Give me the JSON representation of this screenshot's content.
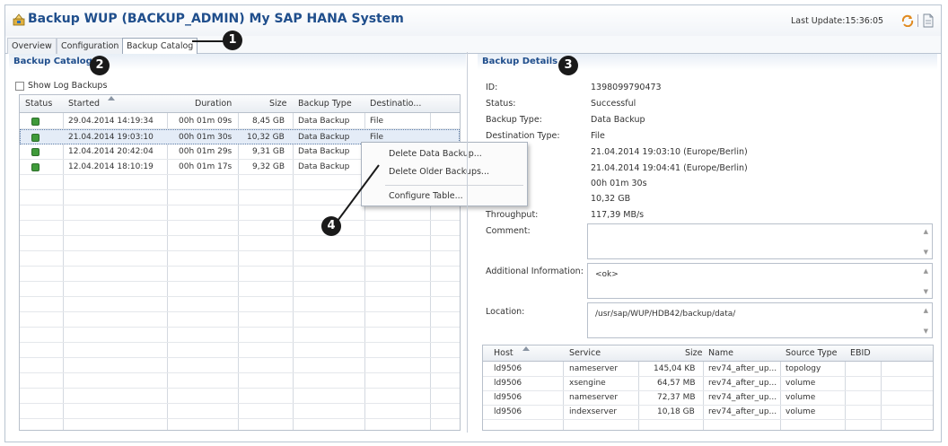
{
  "window": {
    "title": "Backup WUP (BACKUP_ADMIN) My SAP HANA System",
    "last_update": "Last Update:15:36:05"
  },
  "tabs": [
    {
      "label": "Overview"
    },
    {
      "label": "Configuration"
    },
    {
      "label": "Backup Catalog"
    }
  ],
  "callouts": [
    "1",
    "2",
    "3",
    "4"
  ],
  "catalog": {
    "header": "Backup Catalog",
    "show_log_label": "Show Log Backups",
    "columns": [
      "Status",
      "Started",
      "Duration",
      "Size",
      "Backup Type",
      "Destinatio..."
    ],
    "rows": [
      {
        "started": "29.04.2014 14:19:34",
        "duration": "00h 01m 09s",
        "size": "8,45 GB",
        "type": "Data Backup",
        "dest": "File"
      },
      {
        "started": "21.04.2014 19:03:10",
        "duration": "00h 01m 30s",
        "size": "10,32 GB",
        "type": "Data Backup",
        "dest": "File"
      },
      {
        "started": "12.04.2014 20:42:04",
        "duration": "00h 01m 29s",
        "size": "9,31 GB",
        "type": "Data Backup",
        "dest": ""
      },
      {
        "started": "12.04.2014 18:10:19",
        "duration": "00h 01m 17s",
        "size": "9,32 GB",
        "type": "Data Backup",
        "dest": ""
      }
    ],
    "status_color": "#3f9a3a"
  },
  "context_menu": {
    "items": [
      "Delete Data Backup...",
      "Delete Older Backups...",
      "Configure Table..."
    ]
  },
  "details": {
    "header": "Backup Details",
    "id_label": "ID:",
    "id_value": "1398099790473",
    "status_label": "Status:",
    "status_value": "Successful",
    "type_label": "Backup Type:",
    "type_value": "Data Backup",
    "dest_label": "Destination Type:",
    "dest_value": "File",
    "started_value": "21.04.2014 19:03:10 (Europe/Berlin)",
    "finished_value": "21.04.2014 19:04:41 (Europe/Berlin)",
    "duration_value": "00h 01m 30s",
    "size_value": "10,32 GB",
    "throughput_label": "Throughput:",
    "throughput_value": "117,39 MB/s",
    "comment_label": "Comment:",
    "addinfo_label": "Additional Information:",
    "addinfo_value": "<ok>",
    "location_label": "Location:",
    "location_value": "/usr/sap/WUP/HDB42/backup/data/"
  },
  "hosts": {
    "columns": [
      "Host",
      "Service",
      "Size",
      "Name",
      "Source Type",
      "EBID"
    ],
    "rows": [
      {
        "host": "ld9506",
        "service": "nameserver",
        "size": "145,04 KB",
        "name": "rev74_after_up...",
        "source": "topology"
      },
      {
        "host": "ld9506",
        "service": "xsengine",
        "size": "64,57 MB",
        "name": "rev74_after_up...",
        "source": "volume"
      },
      {
        "host": "ld9506",
        "service": "nameserver",
        "size": "72,37 MB",
        "name": "rev74_after_up...",
        "source": "volume"
      },
      {
        "host": "ld9506",
        "service": "indexserver",
        "size": "10,18 GB",
        "name": "rev74_after_up...",
        "source": "volume"
      }
    ]
  }
}
